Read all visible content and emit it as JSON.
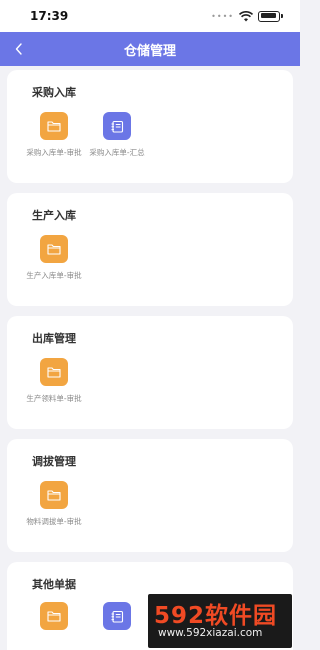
{
  "status_bar": {
    "time": "17:39"
  },
  "nav": {
    "title": "仓储管理"
  },
  "sections": [
    {
      "title": "采购入库",
      "items": [
        {
          "label": "采购入库单-审批",
          "icon": "folder-icon",
          "color": "#f2a541"
        },
        {
          "label": "采购入库单-汇总",
          "icon": "notebook-icon",
          "color": "#6b76e6"
        }
      ]
    },
    {
      "title": "生产入库",
      "items": [
        {
          "label": "生产入库单-审批",
          "icon": "folder-icon",
          "color": "#f2a541"
        }
      ]
    },
    {
      "title": "出库管理",
      "items": [
        {
          "label": "生产领料单-审批",
          "icon": "folder-icon",
          "color": "#f2a541"
        }
      ]
    },
    {
      "title": "调拔管理",
      "items": [
        {
          "label": "物料调拔单-审批",
          "icon": "folder-icon",
          "color": "#f2a541"
        }
      ]
    },
    {
      "title": "其他单据",
      "items": [
        {
          "label": "",
          "icon": "folder-icon",
          "color": "#f2a541"
        },
        {
          "label": "",
          "icon": "notebook-icon",
          "color": "#6b76e6"
        }
      ]
    }
  ],
  "watermark": {
    "logo": "592软件园",
    "url": "www.592xiazai.com"
  },
  "colors": {
    "accent": "#6b76e6",
    "folder": "#f2a541",
    "background": "#f2f2f6"
  }
}
